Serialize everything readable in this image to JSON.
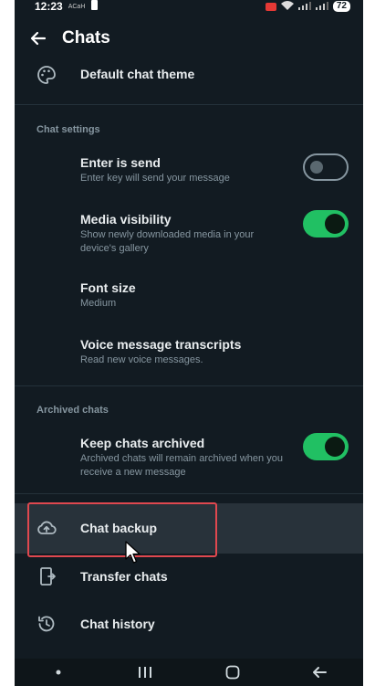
{
  "status_bar": {
    "time": "12:23",
    "small_label": "ACaH",
    "battery": "72"
  },
  "header": {
    "title": "Chats"
  },
  "items": {
    "theme": {
      "title": "Default chat theme"
    },
    "chat_settings_header": "Chat settings",
    "enter_is_send": {
      "title": "Enter is send",
      "subtitle": "Enter key will send your message",
      "enabled": false
    },
    "media_visibility": {
      "title": "Media visibility",
      "subtitle": "Show newly downloaded media in your device's gallery",
      "enabled": true
    },
    "font_size": {
      "title": "Font size",
      "subtitle": "Medium"
    },
    "voice_transcripts": {
      "title": "Voice message transcripts",
      "subtitle": "Read new voice messages."
    },
    "archived_header": "Archived chats",
    "keep_archived": {
      "title": "Keep chats archived",
      "subtitle": "Archived chats will remain archived when you receive a new message",
      "enabled": true
    },
    "chat_backup": {
      "title": "Chat backup"
    },
    "transfer_chats": {
      "title": "Transfer chats"
    },
    "chat_history": {
      "title": "Chat history"
    }
  },
  "colors": {
    "background": "#121b22",
    "accent_green": "#21c063",
    "highlight_border": "#e0484f",
    "secondary_text": "#8696a0"
  },
  "icons": {
    "back": "arrow-left-icon",
    "theme": "palette-icon",
    "backup": "cloud-upload-icon",
    "transfer": "phone-transfer-icon",
    "history": "history-icon"
  }
}
